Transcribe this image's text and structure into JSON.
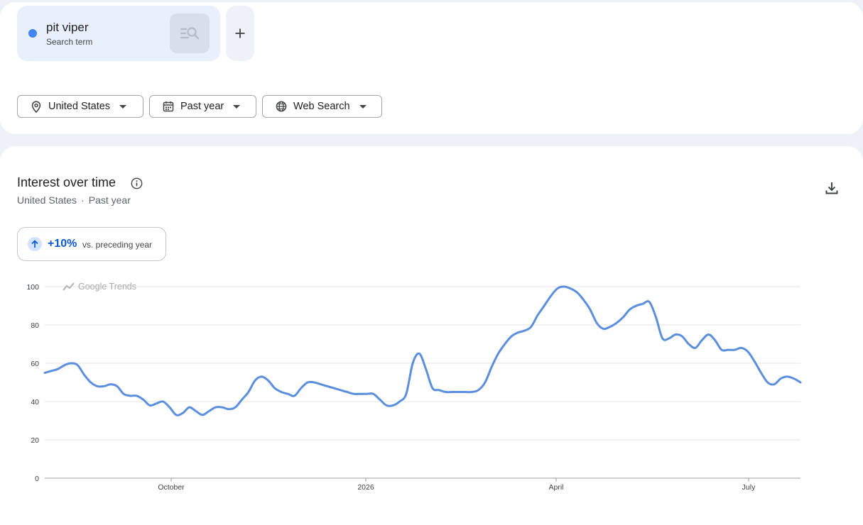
{
  "search_term": {
    "name": "pit viper",
    "type_label": "Search term",
    "color": "#4285f4",
    "action_icon": "compare-search-icon"
  },
  "add_term": {
    "icon": "plus-icon",
    "label": "+"
  },
  "filters": [
    {
      "icon": "location-pin-icon",
      "label": "United States"
    },
    {
      "icon": "calendar-icon",
      "label": "Past year"
    },
    {
      "icon": "globe-icon",
      "label": "Web Search"
    }
  ],
  "section": {
    "title": "Interest over time",
    "subtitle_region": "United States",
    "subtitle_separator": "·",
    "subtitle_period": "Past year",
    "change_value": "+10%",
    "change_label": "vs. preceding year",
    "watermark": "Google Trends"
  },
  "colors": {
    "accent": "#0b57d0",
    "line": "#5b8fde",
    "chip_bg": "#e8f0fe"
  },
  "chart_data": {
    "type": "line",
    "title": "",
    "xlabel": "",
    "ylabel": "",
    "ylim": [
      0,
      100
    ],
    "yticks": [
      0,
      20,
      40,
      60,
      80,
      100
    ],
    "xticks": [
      "October",
      "2026",
      "April",
      "July"
    ],
    "grid": true,
    "series": [
      {
        "values": [
          55,
          56,
          57,
          59,
          60,
          59,
          54,
          50,
          48,
          48,
          49,
          48,
          44,
          43,
          43,
          41,
          38,
          39,
          40,
          37,
          33,
          34,
          37,
          35,
          33,
          35,
          37,
          37,
          36,
          37,
          41,
          45,
          51,
          53,
          51,
          47,
          45,
          44,
          43,
          47,
          50,
          50,
          49,
          48,
          47,
          46,
          45,
          44,
          44,
          44,
          44,
          41,
          38,
          38,
          40,
          44,
          60,
          65,
          57,
          47,
          46,
          45,
          45,
          45,
          45,
          45,
          46,
          50,
          58,
          65,
          70,
          74,
          76,
          77,
          79,
          85,
          90,
          95,
          99,
          100,
          99,
          97,
          93,
          88,
          81,
          78,
          79,
          81,
          84,
          88,
          90,
          91,
          92,
          84,
          73,
          73,
          75,
          74,
          70,
          68,
          72,
          75,
          72,
          67,
          67,
          67,
          68,
          66,
          61,
          55,
          50,
          49,
          52,
          53,
          52,
          50
        ]
      }
    ]
  }
}
